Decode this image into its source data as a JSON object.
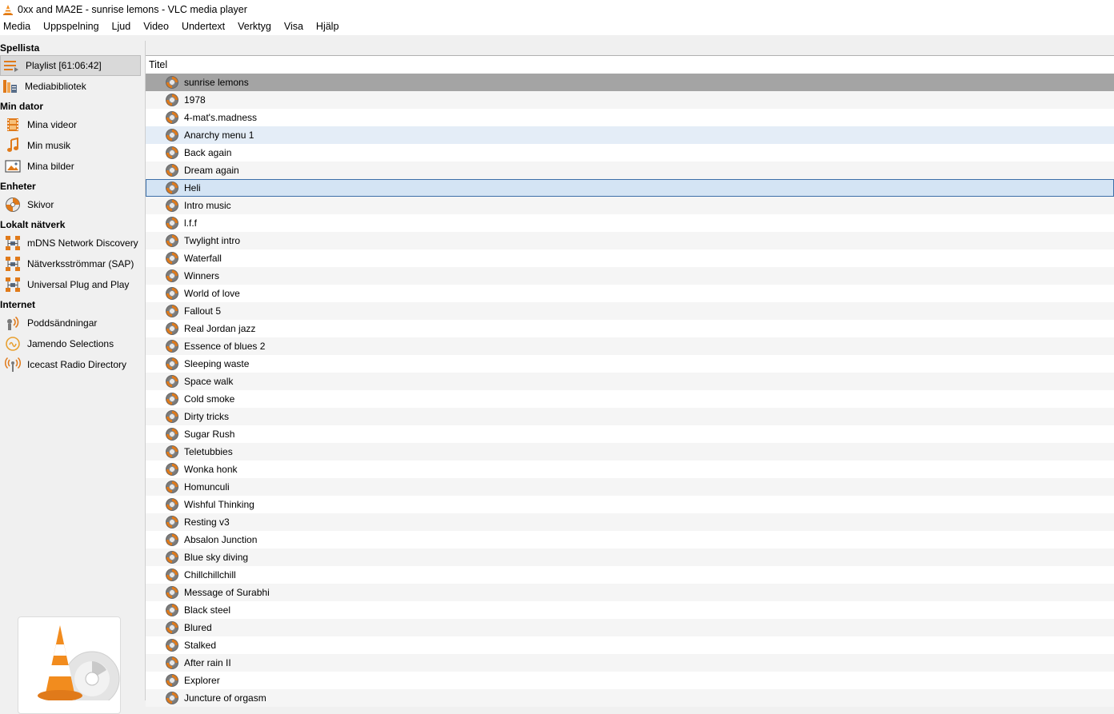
{
  "window": {
    "title": "0xx and MA2E - sunrise lemons - VLC media player"
  },
  "menu": [
    "Media",
    "Uppspelning",
    "Ljud",
    "Video",
    "Undertext",
    "Verktyg",
    "Visa",
    "Hjälp"
  ],
  "sidebar": {
    "header": "Spellista",
    "playlist_label": "Playlist [61:06:42]",
    "media_library": "Mediabibliotek",
    "sections": [
      {
        "title": "Min dator",
        "items": [
          "Mina videor",
          "Min musik",
          "Mina bilder"
        ]
      },
      {
        "title": "Enheter",
        "items": [
          "Skivor"
        ]
      },
      {
        "title": "Lokalt nätverk",
        "items": [
          "mDNS Network Discovery",
          "Nätverksströmmar (SAP)",
          "Universal Plug and Play"
        ]
      },
      {
        "title": "Internet",
        "items": [
          "Poddsändningar",
          "Jamendo Selections",
          "Icecast Radio Directory"
        ]
      }
    ]
  },
  "playlist": {
    "column_title": "Titel",
    "rows": [
      "sunrise lemons",
      "1978",
      "4-mat's.madness",
      "Anarchy menu 1",
      "Back again",
      "Dream again",
      "Heli",
      "Intro music",
      "l.f.f",
      "Twylight intro",
      "Waterfall",
      "Winners",
      "World of love",
      "Fallout 5",
      "Real Jordan jazz",
      "Essence of blues 2",
      "Sleeping waste",
      "Space walk",
      "Cold smoke",
      "Dirty tricks",
      "Sugar Rush",
      "Teletubbies",
      "Wonka honk",
      "Homunculi",
      "Wishful Thinking",
      "Resting v3",
      "Absalon Junction",
      "Blue sky diving",
      "Chillchillchill",
      "Message of Surabhi",
      "Black steel",
      "Blured",
      "Stalked",
      "After rain II",
      "Explorer",
      "Juncture of orgasm"
    ],
    "playing_index": 0,
    "hover_index": 3,
    "selected_index": 6
  },
  "colors": {
    "accent_orange": "#e07a1a",
    "selection_border": "#3c6fa8",
    "playing_bg": "#a4a4a4"
  }
}
